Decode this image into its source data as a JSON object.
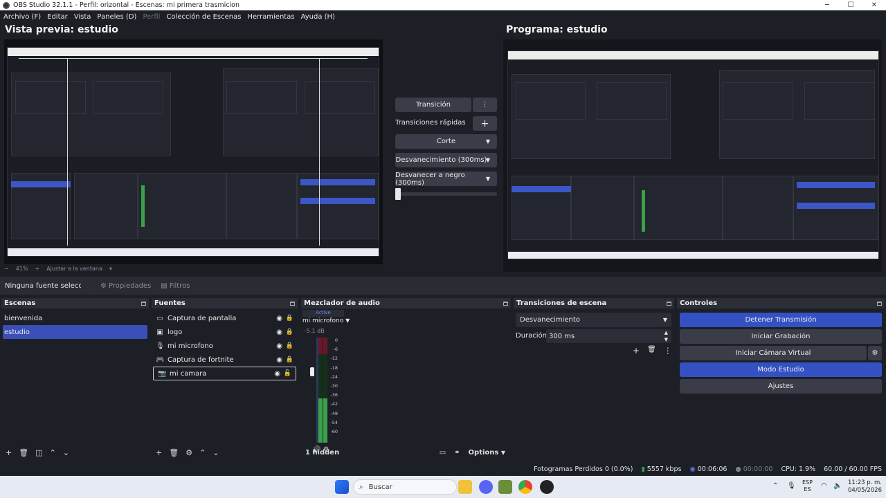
{
  "window": {
    "title": "OBS Studio 32.1.1 - Perfil: orizontal - Escenas: mi primera trasmicion",
    "controls": [
      "─",
      "☐",
      "✕"
    ]
  },
  "menu": [
    "Archivo (F)",
    "Editar",
    "Vista",
    "Paneles (D)",
    "Perfil",
    "Colección de Escenas",
    "Herramientas",
    "Ayuda (H)"
  ],
  "preview": {
    "left_title": "Vista previa: estudio",
    "right_title": "Programa: estudio",
    "zoom_minus": "−",
    "zoom_value": "41%",
    "zoom_plus": "+",
    "zoom_fit": "Ajustar a la ventana"
  },
  "transitions_panel": {
    "transition_button": "Transición",
    "quick_label": "Transiciones rápidas",
    "quick": [
      "Corte",
      "Desvanecimiento (300ms)",
      "Desvanecer a negro (300ms)"
    ]
  },
  "source_toolbar": {
    "no_source": "Ninguna fuente seleccionada",
    "properties": "Propiedades",
    "filters": "Filtros"
  },
  "scenes": {
    "title": "Escenas",
    "items": [
      "bienvenida",
      "estudio"
    ],
    "active_index": 1
  },
  "sources": {
    "title": "Fuentes",
    "items": [
      {
        "name": "Captura de pantalla",
        "icon": "monitor-icon"
      },
      {
        "name": "logo",
        "icon": "image-icon"
      },
      {
        "name": "mi microfono",
        "icon": "microphone-icon"
      },
      {
        "name": "Captura de fortnite",
        "icon": "gamepad-icon"
      },
      {
        "name": "mi camara",
        "icon": "camera-icon"
      }
    ]
  },
  "mixer": {
    "title": "Mezclador de audio",
    "status": "Active",
    "channel": "mi microfono",
    "db": "-5.1 dB",
    "scale": [
      "0",
      "-6",
      "-12",
      "-18",
      "-24",
      "-30",
      "-36",
      "-42",
      "-48",
      "-54",
      "-60"
    ],
    "hidden": "1 hidden",
    "options": "Options"
  },
  "scene_transitions": {
    "title": "Transiciones de escena",
    "selected": "Desvanecimiento",
    "duration_label": "Duración",
    "duration_value": "300 ms"
  },
  "controls": {
    "title": "Controles",
    "stop_stream": "Detener Transmisión",
    "start_record": "Iniciar Grabación",
    "virtual_cam": "Iniciar Cámara Virtual",
    "studio_mode": "Modo Estudio",
    "settings": "Ajustes"
  },
  "status": {
    "dropped": "Fotogramas Perdidos 0 (0.0%)",
    "bitrate": "5557 kbps",
    "stream_time": "00:06:06",
    "record_time": "00:00:00",
    "cpu": "CPU: 1.9%",
    "fps": "60.00 / 60.00 FPS"
  },
  "taskbar": {
    "search": "Buscar",
    "lang_top": "ESP",
    "lang_bottom": "ES",
    "time": "11:23 p. m.",
    "date": "04/05/2026"
  },
  "colors": {
    "accent_blue": "#3451c4",
    "meter_green": "#3aa14a",
    "meter_red": "#8a1e2c"
  }
}
